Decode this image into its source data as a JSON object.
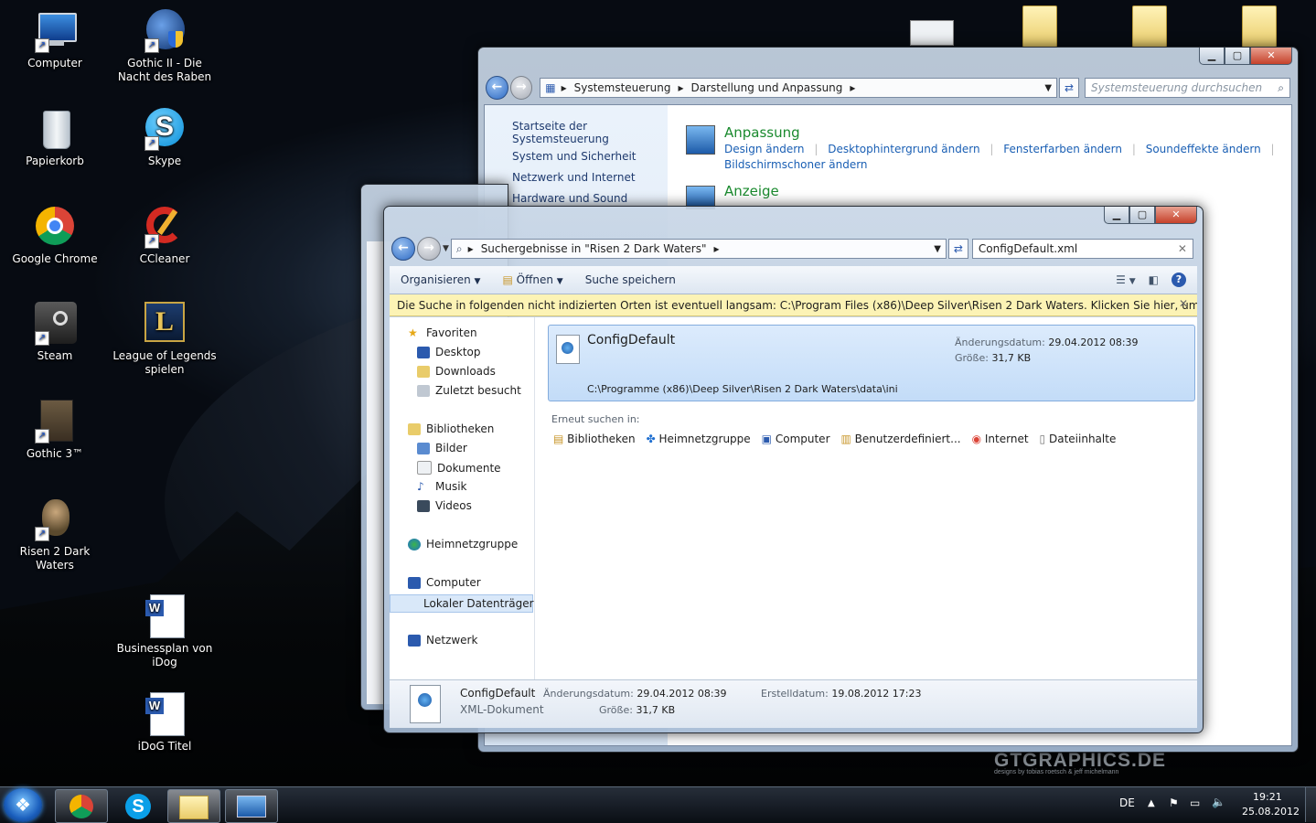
{
  "desktop": {
    "icons": [
      {
        "label": "Computer"
      },
      {
        "label": "Papierkorb"
      },
      {
        "label": "Google Chrome"
      },
      {
        "label": "Steam"
      },
      {
        "label": "Gothic 3™"
      },
      {
        "label": "Risen 2 Dark Waters"
      },
      {
        "label": "Gothic II - Die Nacht des Raben"
      },
      {
        "label": "Skype"
      },
      {
        "label": "CCleaner"
      },
      {
        "label": "League of Legends spielen"
      },
      {
        "label": "Businessplan von iDog"
      },
      {
        "label": "iDoG Titel"
      }
    ],
    "watermark": "GTGRAPHICS.DE",
    "watermark_sub": "designs by tobias roetsch & jeff michelmann"
  },
  "control_panel": {
    "crumb_root": "Systemsteuerung",
    "crumb_current": "Darstellung und Anpassung",
    "search_placeholder": "Systemsteuerung durchsuchen",
    "sidebar": [
      "Startseite der Systemsteuerung",
      "System und Sicherheit",
      "Netzwerk und Internet",
      "Hardware und Sound"
    ],
    "categories": [
      {
        "title": "Anpassung",
        "links": [
          "Design ändern",
          "Desktophintergrund ändern",
          "Fensterfarben ändern",
          "Soundeffekte ändern",
          "Bildschirmschoner ändern"
        ]
      },
      {
        "title": "Anzeige",
        "links": []
      }
    ]
  },
  "explorer": {
    "address": "Suchergebnisse in \"Risen 2 Dark Waters\"",
    "search_value": "ConfigDefault.xml",
    "toolbar": {
      "organize": "Organisieren",
      "open": "Öffnen",
      "save_search": "Suche speichern"
    },
    "info_bar": "Die Suche in folgenden nicht indizierten Orten ist eventuell langsam: C:\\Program Files (x86)\\Deep Silver\\Risen 2 Dark Waters. Klicken Sie hier, um die Orte zum ...",
    "nav": {
      "favorites": "Favoriten",
      "desktop": "Desktop",
      "downloads": "Downloads",
      "recent": "Zuletzt besucht",
      "libraries": "Bibliotheken",
      "pictures": "Bilder",
      "documents": "Dokumente",
      "music": "Musik",
      "videos": "Videos",
      "homegroup": "Heimnetzgruppe",
      "computer": "Computer",
      "local_disk": "Lokaler Datenträger",
      "network": "Netzwerk"
    },
    "result": {
      "name": "ConfigDefault",
      "modified_label": "Änderungsdatum:",
      "modified": "29.04.2012 08:39",
      "size_label": "Größe:",
      "size": "31,7 KB",
      "path": "C:\\Programme (x86)\\Deep Silver\\Risen 2 Dark Waters\\data\\ini"
    },
    "search_again": {
      "label": "Erneut suchen in:",
      "items": [
        "Bibliotheken",
        "Heimnetzgruppe",
        "Computer",
        "Benutzerdefiniert...",
        "Internet",
        "Dateiinhalte"
      ]
    },
    "details": {
      "name": "ConfigDefault",
      "type": "XML-Dokument",
      "modified_label": "Änderungsdatum:",
      "modified": "29.04.2012 08:39",
      "size_label": "Größe:",
      "size": "31,7 KB",
      "created_label": "Erstelldatum:",
      "created": "19.08.2012 17:23"
    }
  },
  "taskbar": {
    "lang": "DE",
    "time": "19:21",
    "date": "25.08.2012"
  }
}
